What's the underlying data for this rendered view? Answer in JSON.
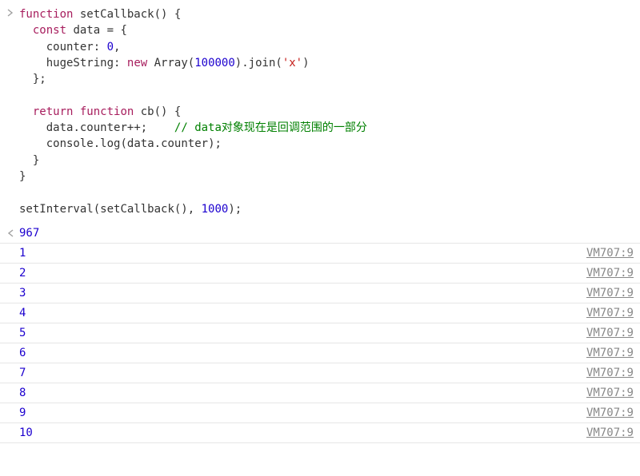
{
  "input": {
    "code_html": "<span class='kw'>function</span> <span class='name'>setCallback</span><span class='punct'>() {</span>\n  <span class='kw'>const</span> <span class='name'>data</span> <span class='punct'>= {</span>\n    <span class='prop'>counter</span><span class='punct'>:</span> <span class='num'>0</span><span class='punct'>,</span>\n    <span class='prop'>hugeString</span><span class='punct'>:</span> <span class='kw'>new</span> <span class='name'>Array</span><span class='punct'>(</span><span class='num'>100000</span><span class='punct'>).</span><span class='name'>join</span><span class='punct'>(</span><span class='str'>'x'</span><span class='punct'>)</span>\n  <span class='punct'>};</span>\n\n  <span class='kw'>return</span> <span class='kw'>function</span> <span class='name'>cb</span><span class='punct'>() {</span>\n    <span class='name'>data</span><span class='punct'>.</span><span class='prop'>counter</span><span class='punct'>++;</span>    <span class='cmt'>// data对象现在是回调范围的一部分</span>\n    <span class='name'>console</span><span class='punct'>.</span><span class='name'>log</span><span class='punct'>(</span><span class='name'>data</span><span class='punct'>.</span><span class='prop'>counter</span><span class='punct'>);</span>\n  <span class='punct'>}</span>\n<span class='punct'>}</span>\n\n<span class='name'>setInterval</span><span class='punct'>(</span><span class='name'>setCallback</span><span class='punct'>(),</span> <span class='num'>1000</span><span class='punct'>);</span>"
  },
  "repeat_count": "967",
  "logs": [
    {
      "value": "1",
      "source": "VM707:9"
    },
    {
      "value": "2",
      "source": "VM707:9"
    },
    {
      "value": "3",
      "source": "VM707:9"
    },
    {
      "value": "4",
      "source": "VM707:9"
    },
    {
      "value": "5",
      "source": "VM707:9"
    },
    {
      "value": "6",
      "source": "VM707:9"
    },
    {
      "value": "7",
      "source": "VM707:9"
    },
    {
      "value": "8",
      "source": "VM707:9"
    },
    {
      "value": "9",
      "source": "VM707:9"
    },
    {
      "value": "10",
      "source": "VM707:9"
    }
  ]
}
